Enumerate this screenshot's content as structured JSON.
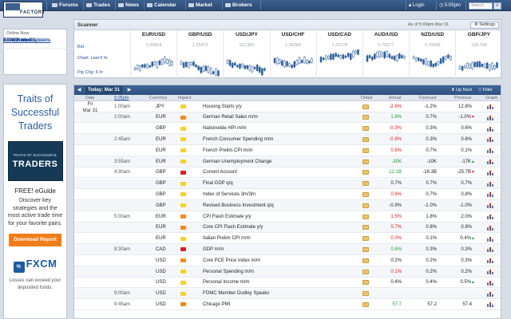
{
  "nav": {
    "logo_text": "FACTORY",
    "items": [
      "Forums",
      "Trades",
      "News",
      "Calendar",
      "Market",
      "Brokers"
    ],
    "login": "Login",
    "time": "5:05pm",
    "search_placeholder": "Search"
  },
  "online": {
    "header": "Online Now",
    "traders": "4,393 Traders",
    "members": "533 Members",
    "impact": "33 High Impact",
    "explorers": "72 w/ Trade Explorers",
    "posted": "19 w/ Posted Systems"
  },
  "ad": {
    "headline": "Traits of Successful Traders",
    "book_small": "TRAITS OF SUCCESSFUL",
    "book_big": "TRADERS",
    "free": "FREE! eGuide",
    "body": "Discover key strategies and the most active trade time for your favorite pairs.",
    "button": "Download Report",
    "brand": "FXCM",
    "disclaimer": "Losses can exceed your deposited funds."
  },
  "scanner": {
    "title": "Scanner",
    "asof": "As of 5:00pm Mar 31",
    "settings": "Settings",
    "labels": [
      "Bid",
      "Chart: Last 6 hr",
      "Pip Chg: 6 hr"
    ],
    "pairs": [
      {
        "name": "EUR/USD",
        "price": "1.06564"
      },
      {
        "name": "GBP/USD",
        "price": "1.25475"
      },
      {
        "name": "USD/JPY",
        "price": "111.381"
      },
      {
        "name": "USD/CHF",
        "price": "1.00266"
      },
      {
        "name": "USD/CAD",
        "price": "1.33178"
      },
      {
        "name": "AUD/USD",
        "price": "0.76277"
      },
      {
        "name": "NZD/USD",
        "price": "0.70049"
      },
      {
        "name": "GBP/JPY",
        "price": "139.758"
      }
    ]
  },
  "calendar": {
    "today": "Today: Mar 31",
    "up_next": "Up Next",
    "filter": "Filter",
    "columns": [
      "Date",
      "5:05pm",
      "Currency",
      "Impact",
      "Detail",
      "Actual",
      "Forecast",
      "Previous",
      "Graph"
    ],
    "date_day": "Fri",
    "date": "Mar 31",
    "colors": {
      "high": "#d3202b",
      "medium": "#f08a24",
      "low": "#f2d22e"
    },
    "rows": [
      {
        "time": "1:00am",
        "cur": "JPY",
        "impact": "low",
        "event": "Housing Starts y/y",
        "actual": "-2.6%",
        "actual_color": "red",
        "forecast": "-1.2%",
        "previous": "12.8%",
        "prev_flag": ""
      },
      {
        "time": "2:00am",
        "cur": "EUR",
        "impact": "medium",
        "event": "German Retail Sales m/m",
        "actual": "1.8%",
        "actual_color": "green",
        "forecast": "0.7%",
        "previous": "-1.0%",
        "prev_flag": "down"
      },
      {
        "time": "",
        "cur": "GBP",
        "impact": "low",
        "event": "Nationwide HPI m/m",
        "actual": "-0.3%",
        "actual_color": "red",
        "forecast": "0.3%",
        "previous": "0.6%",
        "prev_flag": ""
      },
      {
        "time": "2:45am",
        "cur": "EUR",
        "impact": "low",
        "event": "French Consumer Spending m/m",
        "actual": "-0.8%",
        "actual_color": "red",
        "forecast": "0.3%",
        "previous": "0.6%",
        "prev_flag": ""
      },
      {
        "time": "",
        "cur": "EUR",
        "impact": "low",
        "event": "French Prelim CPI m/m",
        "actual": "0.6%",
        "actual_color": "red",
        "forecast": "0.7%",
        "previous": "0.1%",
        "prev_flag": ""
      },
      {
        "time": "3:55am",
        "cur": "EUR",
        "impact": "low",
        "event": "German Unemployment Change",
        "actual": "-30K",
        "actual_color": "green",
        "forecast": "-10K",
        "previous": "-17K",
        "prev_flag": "up"
      },
      {
        "time": "4:30am",
        "cur": "GBP",
        "impact": "high",
        "event": "Current Account",
        "actual": "-12.1B",
        "actual_color": "green",
        "forecast": "-16.3B",
        "previous": "-25.7B",
        "prev_flag": "down"
      },
      {
        "time": "",
        "cur": "GBP",
        "impact": "low",
        "event": "Final GDP q/q",
        "actual": "0.7%",
        "actual_color": "black",
        "forecast": "0.7%",
        "previous": "0.7%",
        "prev_flag": ""
      },
      {
        "time": "",
        "cur": "GBP",
        "impact": "low",
        "event": "Index of Services 3m/3m",
        "actual": "0.6%",
        "actual_color": "red",
        "forecast": "0.7%",
        "previous": "0.8%",
        "prev_flag": ""
      },
      {
        "time": "",
        "cur": "GBP",
        "impact": "low",
        "event": "Revised Business Investment q/q",
        "actual": "-0.9%",
        "actual_color": "black",
        "forecast": "-1.0%",
        "previous": "-1.0%",
        "prev_flag": ""
      },
      {
        "time": "5:00am",
        "cur": "EUR",
        "impact": "medium",
        "event": "CPI Flash Estimate y/y",
        "actual": "1.5%",
        "actual_color": "red",
        "forecast": "1.8%",
        "previous": "2.0%",
        "prev_flag": ""
      },
      {
        "time": "",
        "cur": "EUR",
        "impact": "medium",
        "event": "Core CPI Flash Estimate y/y",
        "actual": "0.7%",
        "actual_color": "red",
        "forecast": "0.8%",
        "previous": "0.9%",
        "prev_flag": ""
      },
      {
        "time": "",
        "cur": "EUR",
        "impact": "low",
        "event": "Italian Prelim CPI m/m",
        "actual": "0.0%",
        "actual_color": "red",
        "forecast": "0.1%",
        "previous": "0.4%",
        "prev_flag": "up"
      },
      {
        "time": "8:30am",
        "cur": "CAD",
        "impact": "high",
        "event": "GDP m/m",
        "actual": "0.6%",
        "actual_color": "green",
        "forecast": "0.3%",
        "previous": "0.3%",
        "prev_flag": ""
      },
      {
        "time": "",
        "cur": "USD",
        "impact": "medium",
        "event": "Core PCE Price Index m/m",
        "actual": "0.2%",
        "actual_color": "black",
        "forecast": "0.2%",
        "previous": "0.3%",
        "prev_flag": ""
      },
      {
        "time": "",
        "cur": "USD",
        "impact": "low",
        "event": "Personal Spending m/m",
        "actual": "0.1%",
        "actual_color": "red",
        "forecast": "0.2%",
        "previous": "0.2%",
        "prev_flag": ""
      },
      {
        "time": "",
        "cur": "USD",
        "impact": "low",
        "event": "Personal Income m/m",
        "actual": "0.4%",
        "actual_color": "black",
        "forecast": "0.4%",
        "previous": "0.5%",
        "prev_flag": "up"
      },
      {
        "time": "9:00am",
        "cur": "USD",
        "impact": "low",
        "event": "FOMC Member Dudley Speaks",
        "actual": "",
        "actual_color": "black",
        "forecast": "",
        "previous": "",
        "prev_flag": ""
      },
      {
        "time": "9:45am",
        "cur": "USD",
        "impact": "medium",
        "event": "Chicago PMI",
        "actual": "57.7",
        "actual_color": "green",
        "forecast": "57.2",
        "previous": "57.4",
        "prev_flag": ""
      }
    ]
  }
}
